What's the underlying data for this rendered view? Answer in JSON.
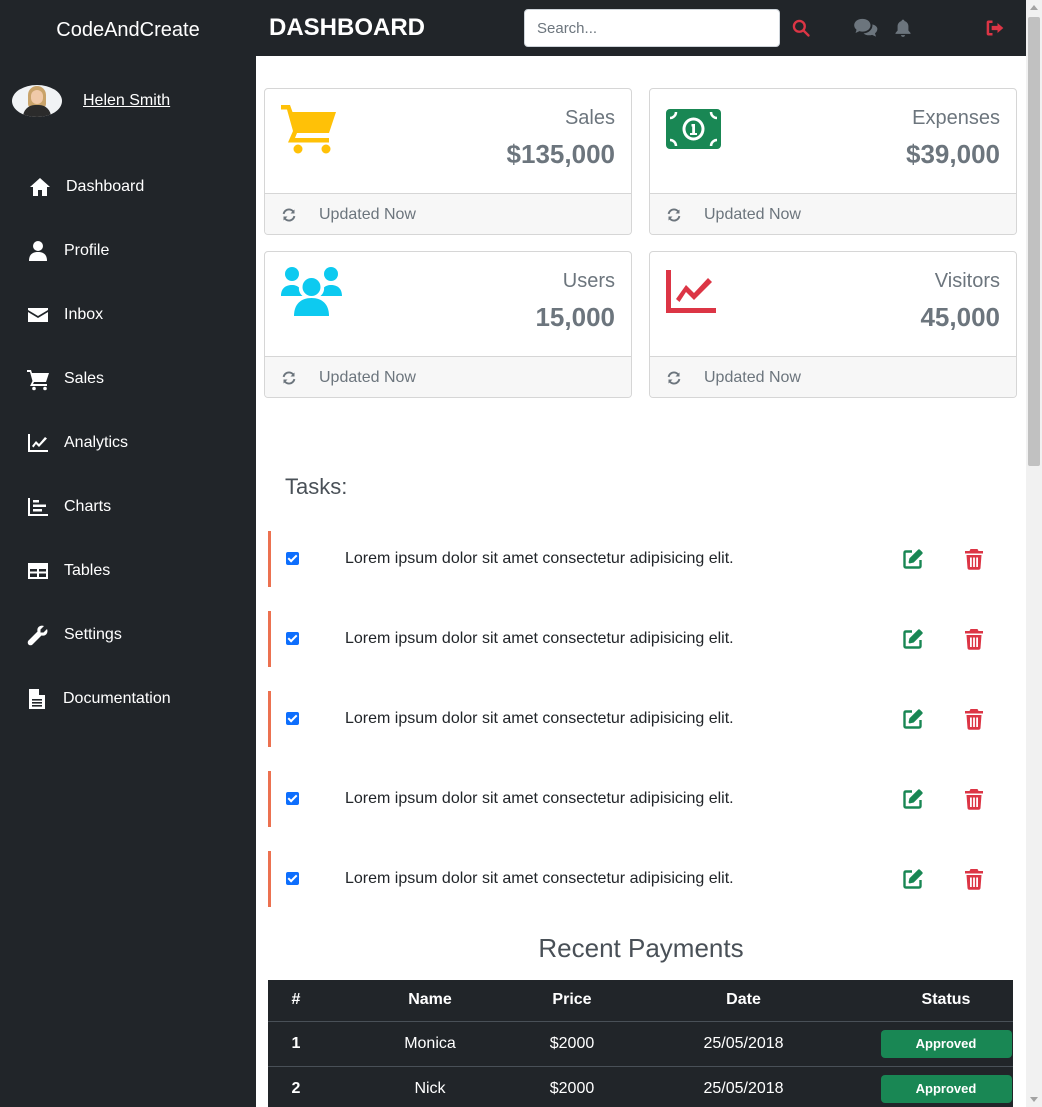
{
  "sidebar": {
    "brand": "CodeAndCreate",
    "user_name": "Helen Smith",
    "items": [
      {
        "label": "Dashboard",
        "icon": "home-icon"
      },
      {
        "label": "Profile",
        "icon": "user-icon"
      },
      {
        "label": "Inbox",
        "icon": "envelope-icon"
      },
      {
        "label": "Sales",
        "icon": "cart-icon"
      },
      {
        "label": "Analytics",
        "icon": "line-chart-icon"
      },
      {
        "label": "Charts",
        "icon": "bar-chart-icon"
      },
      {
        "label": "Tables",
        "icon": "table-icon"
      },
      {
        "label": "Settings",
        "icon": "wrench-icon"
      },
      {
        "label": "Documentation",
        "icon": "file-icon"
      }
    ]
  },
  "topbar": {
    "title": "DASHBOARD",
    "search_placeholder": "Search...",
    "icons": [
      "search-icon",
      "comments-icon",
      "bell-icon",
      "sign-out-icon"
    ]
  },
  "cards": [
    {
      "title": "Sales",
      "value": "$135,000",
      "footer": "Updated Now",
      "icon": "cart-icon",
      "icon_color": "#ffc107"
    },
    {
      "title": "Expenses",
      "value": "$39,000",
      "footer": "Updated Now",
      "icon": "money-bill-icon",
      "icon_color": "#198754"
    },
    {
      "title": "Users",
      "value": "15,000",
      "footer": "Updated Now",
      "icon": "users-icon",
      "icon_color": "#0dcaf0"
    },
    {
      "title": "Visitors",
      "value": "45,000",
      "footer": "Updated Now",
      "icon": "line-chart-icon",
      "icon_color": "#dc3545"
    }
  ],
  "tasks": {
    "title": "Tasks:",
    "items": [
      {
        "text": "Lorem ipsum dolor sit amet consectetur adipisicing elit.",
        "checked": true
      },
      {
        "text": "Lorem ipsum dolor sit amet consectetur adipisicing elit.",
        "checked": true
      },
      {
        "text": "Lorem ipsum dolor sit amet consectetur adipisicing elit.",
        "checked": true
      },
      {
        "text": "Lorem ipsum dolor sit amet consectetur adipisicing elit.",
        "checked": true
      },
      {
        "text": "Lorem ipsum dolor sit amet consectetur adipisicing elit.",
        "checked": true
      }
    ]
  },
  "payments": {
    "title": "Recent Payments",
    "columns": [
      "#",
      "Name",
      "Price",
      "Date",
      "Status"
    ],
    "rows": [
      {
        "num": "1",
        "name": "Monica",
        "price": "$2000",
        "date": "25/05/2018",
        "status": "Approved"
      },
      {
        "num": "2",
        "name": "Nick",
        "price": "$2000",
        "date": "25/05/2018",
        "status": "Approved"
      }
    ]
  },
  "colors": {
    "dark": "#212529",
    "accent_red": "#dc3545",
    "success": "#198754",
    "task_border": "#ec7150",
    "checkbox": "#0d6efd"
  }
}
